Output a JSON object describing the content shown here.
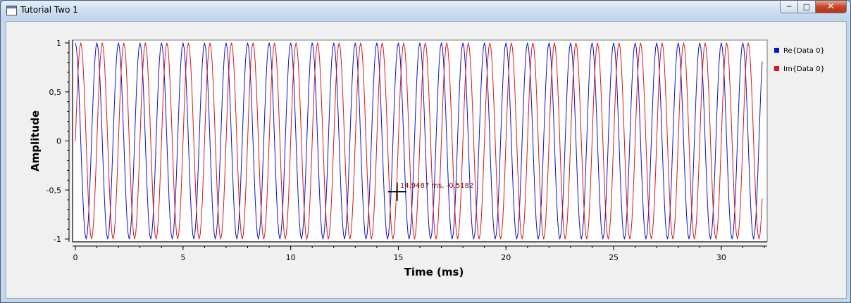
{
  "window": {
    "title": "Tutorial Two 1",
    "controls": {
      "minimize": "─",
      "maximize": "□",
      "close": "✕"
    }
  },
  "chart_data": {
    "type": "line",
    "xlabel": "Time (ms)",
    "ylabel": "Amplitude",
    "xlim": [
      0,
      32
    ],
    "ylim": [
      -1,
      1
    ],
    "x_ticks": [
      0,
      5,
      10,
      15,
      20,
      25,
      30
    ],
    "x_tick_labels": [
      "0",
      "5",
      "10",
      "15",
      "20",
      "25",
      "30"
    ],
    "y_ticks": [
      1,
      0.5,
      0,
      -0.5,
      -1
    ],
    "y_tick_labels": [
      "1",
      "0,5",
      "0",
      "-0,5",
      "-1"
    ],
    "x_data_range": [
      0,
      31.9
    ],
    "sample_step_ms": 0.05,
    "frequency_khz": 1.0,
    "legend_position": "right",
    "series": [
      {
        "name": "Re{Data 0}",
        "function": "cos",
        "color": "#1010c8"
      },
      {
        "name": "Im{Data 0}",
        "function": "sin",
        "color": "#d81818"
      }
    ],
    "cursor": {
      "x": 14.9487,
      "y": -0.5182,
      "label": "14.9487 ms, -0.5182"
    }
  }
}
